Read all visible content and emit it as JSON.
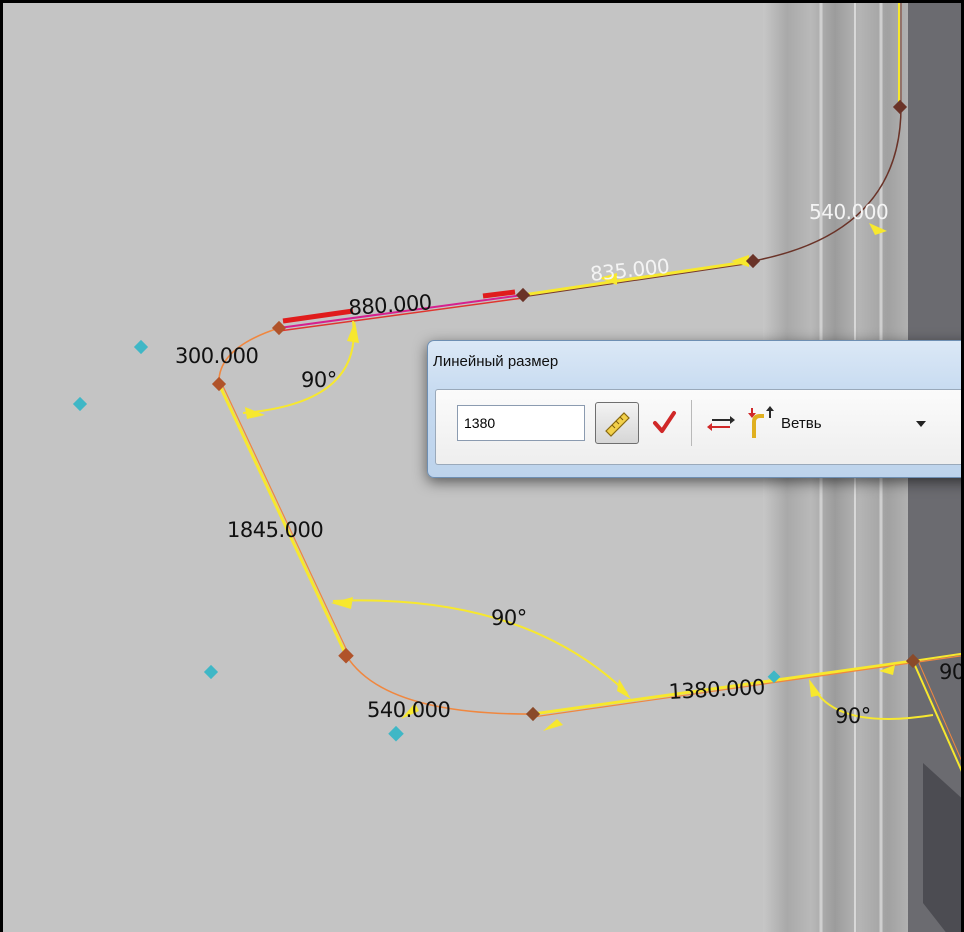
{
  "dimensions": {
    "d540_top": "540.000",
    "d835": "835.000",
    "d880": "880.000",
    "d300": "300.000",
    "angle_top": "90°",
    "d1845": "1845.000",
    "angle_mid": "90°",
    "d540_bottom": "540.000",
    "d1380": "1380.000",
    "angle_right": "90°",
    "edge_label": "90"
  },
  "dialog": {
    "title": "Линейный размер",
    "value": "1380",
    "branch_label": "Ветвь"
  },
  "icons": {
    "measure": "ruler-icon",
    "apply": "checkmark-icon",
    "swap": "swap-arrows-icon",
    "branch": "branch-icon",
    "dropdown": "chevron-down-icon"
  },
  "colors": {
    "viewport_bg": "#c4c4c4",
    "pipe": "#f0873f",
    "dimension_line": "#f7e82e",
    "selected_segment": "#d6208f",
    "node": "#b0532a",
    "marker": "#3fb7c6"
  }
}
